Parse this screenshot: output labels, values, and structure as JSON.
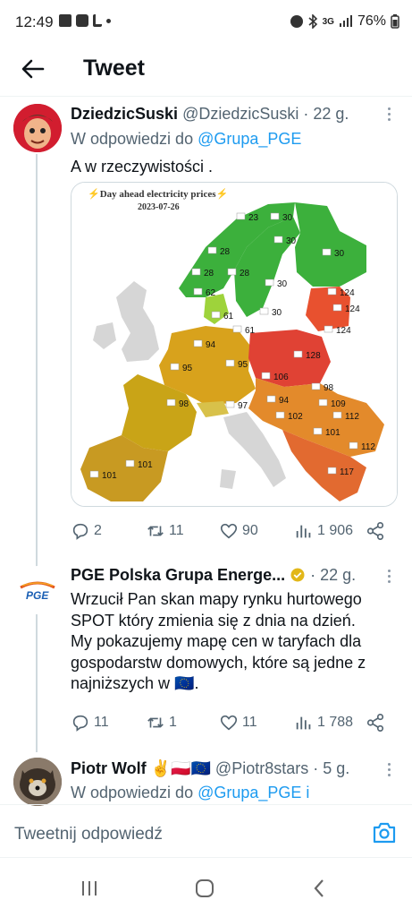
{
  "status_bar": {
    "time": "12:49",
    "network": "3G",
    "battery": "76%"
  },
  "header": {
    "title": "Tweet"
  },
  "tweets": [
    {
      "name": "DziedzicSuski",
      "handle": "@DziedzicSuski",
      "time": "· 22 g.",
      "reply_prefix": "W odpowiedzi do",
      "reply_to": "@Grupa_PGE",
      "text": "A w rzeczywistości .",
      "media": {
        "title": "⚡Day ahead electricity prices⚡",
        "date": "2023-07-26",
        "prices": [
          "23",
          "30",
          "30",
          "28",
          "30",
          "28",
          "28",
          "30",
          "62",
          "124",
          "124",
          "61",
          "61",
          "30",
          "124",
          "94",
          "128",
          "95",
          "95",
          "98",
          "106",
          "98",
          "109",
          "94",
          "97",
          "102",
          "112",
          "101",
          "112",
          "101",
          "101",
          "117"
        ]
      },
      "actions": {
        "replies": "2",
        "retweets": "11",
        "likes": "90",
        "views": "1 906"
      }
    },
    {
      "name": "PGE Polska Grupa Energe...",
      "time": "· 22 g.",
      "text_lines": [
        "Wrzucił Pan skan mapy rynku hurtowego",
        "SPOT który zmienia się z dnia na dzień.",
        "My pokazujemy mapę cen w taryfach dla",
        "gospodarstw domowych, które są jedne z",
        "najniższych w 🇪🇺."
      ],
      "logo_text": "PGE",
      "actions": {
        "replies": "11",
        "retweets": "1",
        "likes": "11",
        "views": "1 788"
      }
    },
    {
      "name": "Piotr Wolf ✌️🇵🇱🇪🇺",
      "handle": "@Piotr8stars",
      "time": "· 5 g.",
      "reply_prefix": "W odpowiedzi do",
      "reply_to": "@Grupa_PGE i"
    }
  ],
  "composer": {
    "placeholder": "Tweetnij odpowiedź"
  },
  "colors": {
    "accent": "#1d9bf0",
    "verified": "#e2b719",
    "text": "#0f1419",
    "muted": "#536471"
  }
}
